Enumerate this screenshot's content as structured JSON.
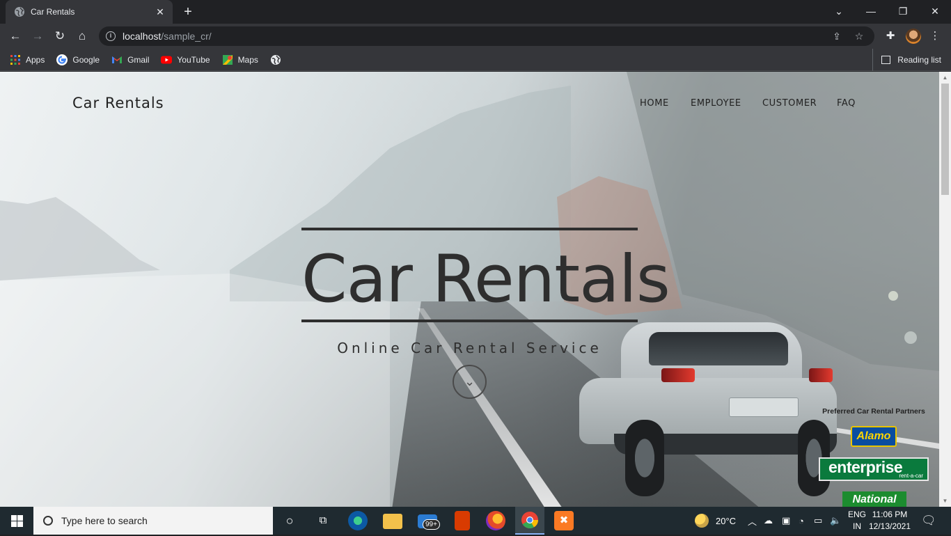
{
  "browser": {
    "tab_title": "Car Rentals",
    "new_tab": "+",
    "url_host": "localhost",
    "url_path": "/sample_cr/",
    "bookmarks": [
      {
        "label": "Apps",
        "icon": "apps-grid-icon"
      },
      {
        "label": "Google",
        "icon": "google-icon"
      },
      {
        "label": "Gmail",
        "icon": "gmail-icon"
      },
      {
        "label": "YouTube",
        "icon": "youtube-icon"
      },
      {
        "label": "Maps",
        "icon": "maps-icon"
      }
    ],
    "reading_list": "Reading list"
  },
  "site": {
    "brand": "Car Rentals",
    "nav": [
      "HOME",
      "EMPLOYEE",
      "CUSTOMER",
      "FAQ"
    ],
    "hero_title": "Car Rentals",
    "hero_subtitle": "Online Car Rental Service",
    "partners_title": "Preferred Car Rental Partners",
    "partners": [
      "Alamo",
      "enterprise",
      "rent-a-car",
      "National"
    ]
  },
  "taskbar": {
    "search_placeholder": "Type here to search",
    "mail_badge": "99+",
    "weather": "20°C",
    "lang_top": "ENG",
    "lang_bottom": "IN",
    "time": "11:06 PM",
    "date": "12/13/2021"
  },
  "colors": {
    "browser_bg": "#202124",
    "toolbar_bg": "#35363a",
    "hero_text": "#2e2e2e",
    "taskbar_bg": "#1f2a30"
  }
}
